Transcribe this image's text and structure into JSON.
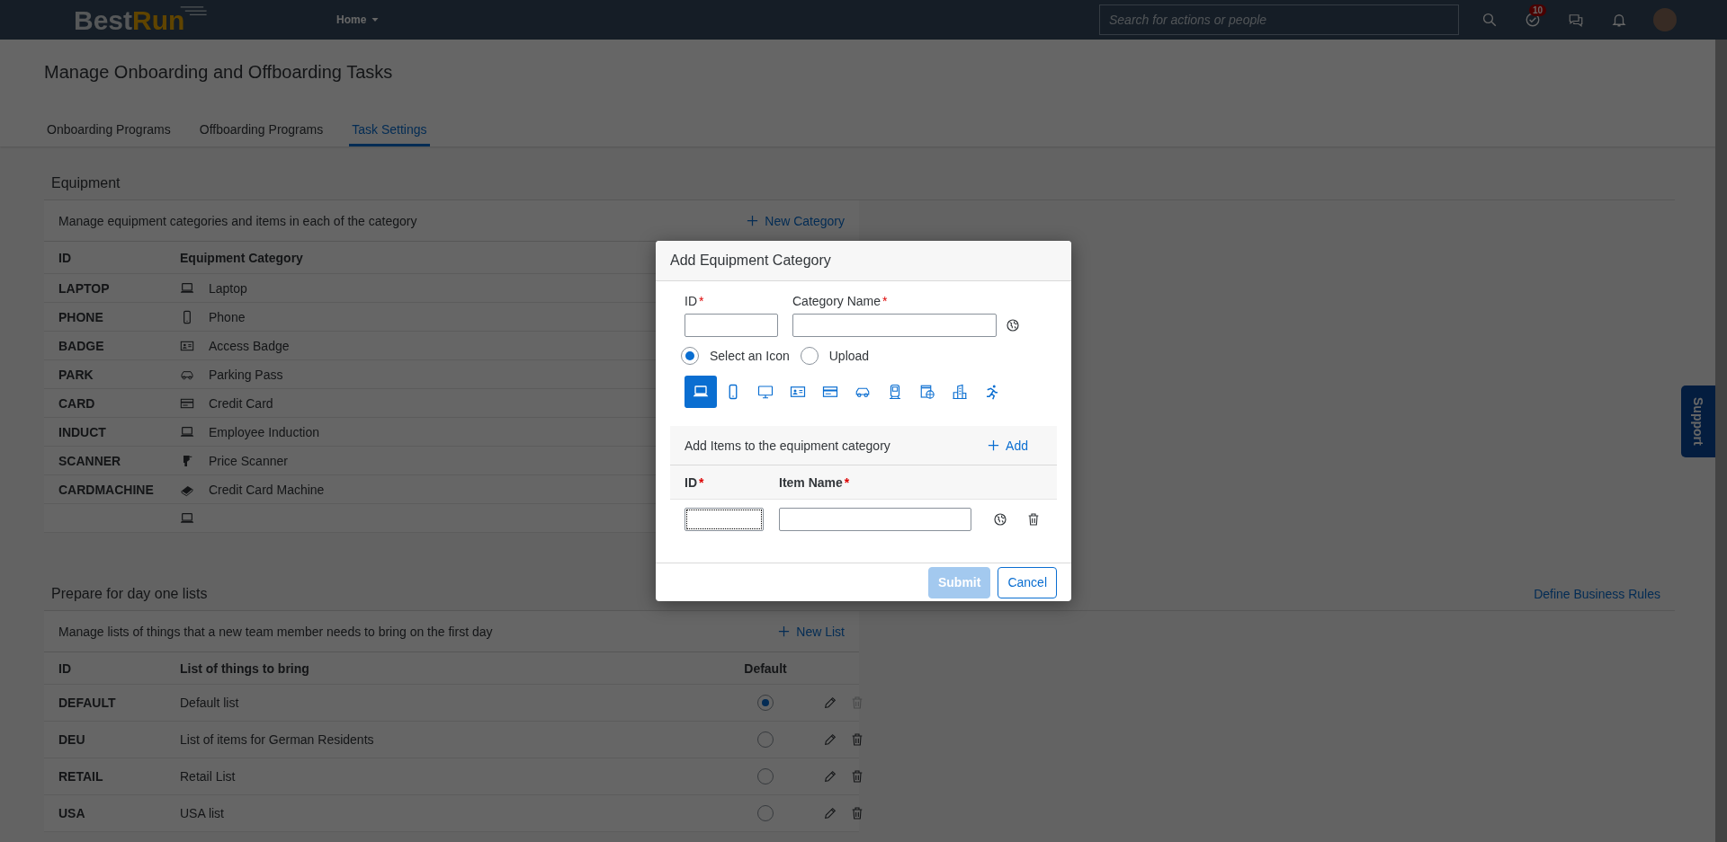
{
  "shell": {
    "logo": [
      "Best",
      "Run"
    ],
    "menu": "Home",
    "search": {
      "placeholder": "Search for actions or people"
    },
    "tasks_badge": "10"
  },
  "page_title": "Manage Onboarding and Offboarding Tasks",
  "tabs": [
    {
      "label": "Onboarding Programs",
      "selected": false
    },
    {
      "label": "Offboarding Programs",
      "selected": false
    },
    {
      "label": "Task Settings",
      "selected": true
    }
  ],
  "equipment": {
    "title": "Equipment",
    "description": "Manage equipment categories and items in each of the category",
    "new_button": "New Category",
    "columns": [
      "ID",
      "Equipment Category"
    ],
    "rows": [
      {
        "id": "LAPTOP",
        "kind": "laptop",
        "name": "Laptop"
      },
      {
        "id": "PHONE",
        "kind": "phone",
        "name": "Phone"
      },
      {
        "id": "BADGE",
        "kind": "badge",
        "name": "Access Badge"
      },
      {
        "id": "PARK",
        "kind": "car",
        "name": "Parking Pass"
      },
      {
        "id": "CARD",
        "kind": "card",
        "name": "Credit Card"
      },
      {
        "id": "INDUCT",
        "kind": "laptop",
        "name": "Employee Induction"
      },
      {
        "id": "SCANNER",
        "kind": "scanner",
        "name": "Price Scanner"
      },
      {
        "id": "CARDMACHINE",
        "kind": "cardmachine",
        "name": "Credit Card Machine"
      },
      {
        "kind": "laptop"
      }
    ]
  },
  "lists": {
    "title": "Prepare for day one lists",
    "link": "Define Business Rules",
    "description": "Manage lists of things that a new team member needs to bring on the first day",
    "new_button": "New List",
    "columns": [
      "ID",
      "List of things to bring",
      "Default"
    ],
    "rows": [
      {
        "id": "DEFAULT",
        "name": "Default list",
        "selected": true,
        "delete_disabled": true
      },
      {
        "id": "DEU",
        "name": "List of items for German Residents",
        "selected": false,
        "delete_disabled": false
      },
      {
        "id": "RETAIL",
        "name": "Retail List",
        "selected": false,
        "delete_disabled": false
      },
      {
        "id": "USA",
        "name": "USA list",
        "selected": false,
        "delete_disabled": false
      }
    ]
  },
  "support": "Support",
  "dialog": {
    "title": "Add Equipment Category",
    "fields": [
      {
        "label": "ID",
        "required_mark": "*",
        "kind": "short"
      },
      {
        "label": "Category Name",
        "required_mark": "*",
        "kind": "translatable"
      }
    ],
    "source_options": [
      {
        "label": "Select an Icon",
        "selected": true
      },
      {
        "label": "Upload",
        "selected": false
      }
    ],
    "icon_choices": [
      {
        "kind": "laptop",
        "selected": true
      },
      {
        "kind": "phone",
        "selected": false
      },
      {
        "kind": "monitor",
        "selected": false
      },
      {
        "kind": "badge",
        "selected": false
      },
      {
        "kind": "card",
        "selected": false
      },
      {
        "kind": "car",
        "selected": false
      },
      {
        "kind": "train",
        "selected": false
      },
      {
        "kind": "web",
        "selected": false
      },
      {
        "kind": "building",
        "selected": false
      },
      {
        "kind": "runner",
        "selected": false
      }
    ],
    "items": {
      "description": "Add Items to the equipment category",
      "add_button": "Add",
      "columns": [
        {
          "label": "ID",
          "required_mark": "*"
        },
        {
          "label": "Item Name",
          "required_mark": "*"
        }
      ],
      "rows": [
        {
          "id_focused": true
        }
      ]
    },
    "buttons": [
      {
        "label": "Submit",
        "kind": "primary",
        "disabled": true
      },
      {
        "label": "Cancel",
        "kind": "secondary",
        "disabled": false
      }
    ]
  }
}
